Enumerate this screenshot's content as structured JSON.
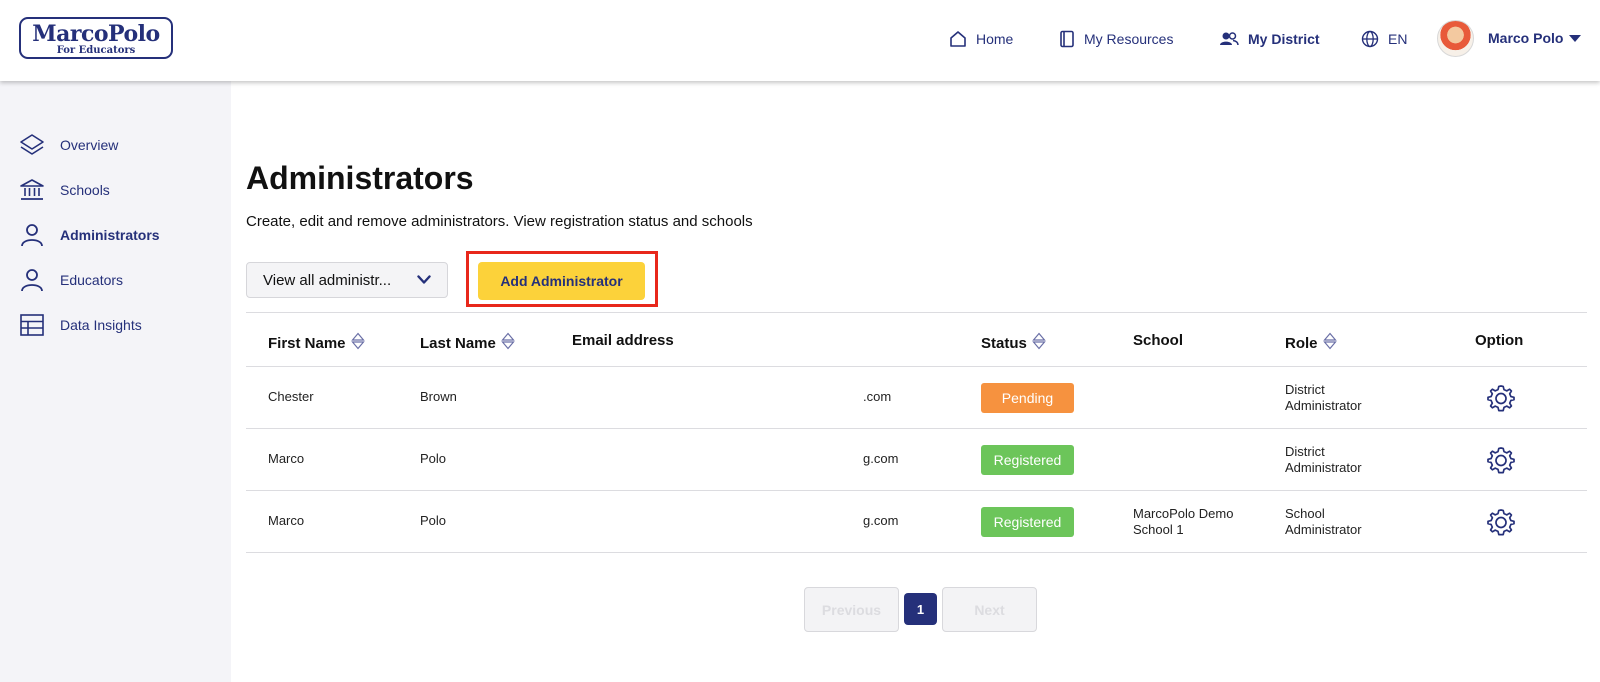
{
  "brand": {
    "line1": "MarcoPolo",
    "line2": "For Educators"
  },
  "nav": {
    "home": "Home",
    "resources": "My Resources",
    "district": "My District",
    "language": "EN",
    "user": "Marco Polo"
  },
  "sidebar": {
    "items": [
      {
        "label": "Overview",
        "icon": "layers-icon"
      },
      {
        "label": "Schools",
        "icon": "bank-icon"
      },
      {
        "label": "Administrators",
        "icon": "user-icon"
      },
      {
        "label": "Educators",
        "icon": "user-icon"
      },
      {
        "label": "Data Insights",
        "icon": "table-icon"
      }
    ],
    "active": "Administrators"
  },
  "page": {
    "title": "Administrators",
    "subtitle": "Create, edit and remove administrators. View registration status and schools",
    "filter_label": "View all administr...",
    "add_button": "Add Administrator"
  },
  "table": {
    "headers": {
      "first_name": "First Name",
      "last_name": "Last Name",
      "email": "Email address",
      "status": "Status",
      "school": "School",
      "role": "Role",
      "option": "Option"
    },
    "rows": [
      {
        "first": "Chester",
        "last": "Brown",
        "email": ".com",
        "status": "Pending",
        "school_1": "",
        "school_2": "",
        "role_1": "District",
        "role_2": "Administrator"
      },
      {
        "first": "Marco",
        "last": "Polo",
        "email": "g.com",
        "status": "Registered",
        "school_1": "",
        "school_2": "",
        "role_1": "District",
        "role_2": "Administrator"
      },
      {
        "first": "Marco",
        "last": "Polo",
        "email": "g.com",
        "status": "Registered",
        "school_1": "MarcoPolo Demo",
        "school_2": "School 1",
        "role_1": "School",
        "role_2": "Administrator"
      }
    ]
  },
  "pagination": {
    "previous": "Previous",
    "current": "1",
    "next": "Next"
  },
  "colors": {
    "brand": "#25307a",
    "accent": "#fcd23a",
    "pending": "#f6923f",
    "registered": "#6cc55a",
    "highlight": "#e8281b"
  }
}
